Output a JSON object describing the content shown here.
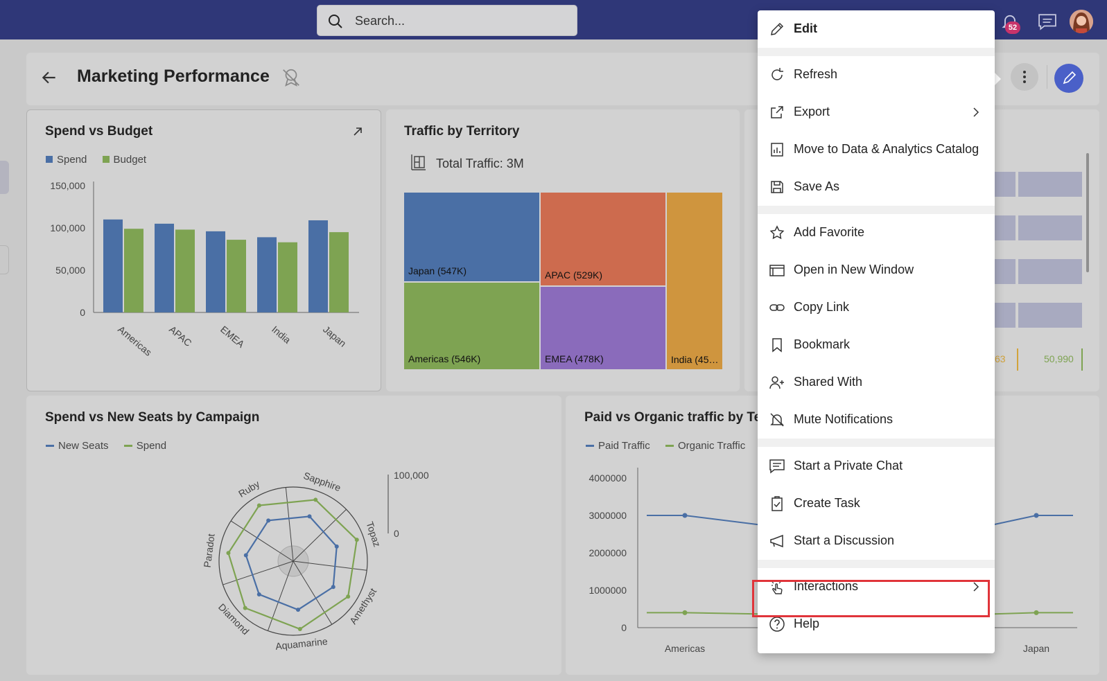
{
  "search": {
    "placeholder": "Search..."
  },
  "notifications": {
    "count": "52"
  },
  "page": {
    "title": "Marketing Performance"
  },
  "spend_budget": {
    "title": "Spend vs Budget",
    "legend": [
      "Spend",
      "Budget"
    ],
    "colors": [
      "#4a6fa5",
      "#7ea352"
    ]
  },
  "traffic": {
    "title": "Traffic by Territory",
    "total": "Total Traffic: 3M",
    "cells": [
      "Japan (547K)",
      "APAC (529K)",
      "Americas (546K)",
      "EMEA (478K)",
      "India (45…"
    ]
  },
  "campaign": {
    "title": "Spend vs New Seats by Campaign",
    "legend": [
      "New Seats",
      "Spend"
    ]
  },
  "paid_organic": {
    "title": "Paid vs Organic traffic by Te",
    "legend": [
      "Paid Traffic",
      "Organic Traffic"
    ]
  },
  "partial_card": {
    "value_a": "63",
    "value_b": "50,990"
  },
  "chart_data": [
    {
      "type": "bar",
      "title": "Spend vs Budget",
      "categories": [
        "Americas",
        "APAC",
        "EMEA",
        "India",
        "Japan"
      ],
      "series": [
        {
          "name": "Spend",
          "values": [
            110000,
            105000,
            96000,
            89000,
            109000
          ]
        },
        {
          "name": "Budget",
          "values": [
            99000,
            98000,
            86000,
            83000,
            95000
          ]
        }
      ],
      "ylim": [
        0,
        150000
      ],
      "yticks": [
        "150,000",
        "100,000",
        "50,000",
        "0"
      ]
    },
    {
      "type": "heatmap",
      "title": "Traffic by Territory",
      "categories": [
        "Japan",
        "APAC",
        "Americas",
        "EMEA",
        "India"
      ],
      "values": [
        547,
        529,
        546,
        478,
        450
      ]
    },
    {
      "type": "line",
      "title": "Spend vs New Seats by Campaign",
      "categories": [
        "Sapphire",
        "Topaz",
        "Amethyst",
        "Aquamarine",
        "Diamond",
        "Paradot",
        "Ruby"
      ],
      "series": [
        {
          "name": "New Seats",
          "values": [
            55000,
            52000,
            55000,
            57000,
            55000,
            55000,
            55000
          ]
        },
        {
          "name": "Spend",
          "values": [
            85000,
            88000,
            85000,
            90000,
            88000,
            85000,
            85000
          ]
        }
      ],
      "ylim": [
        0,
        100000
      ],
      "yticks": [
        "100,000",
        "0"
      ]
    },
    {
      "type": "line",
      "title": "Paid vs Organic traffic by Te",
      "categories": [
        "Americas",
        "Japan"
      ],
      "series": [
        {
          "name": "Paid Traffic",
          "values": [
            3000000,
            3000000
          ]
        },
        {
          "name": "Organic Traffic",
          "values": [
            400000,
            400000
          ]
        }
      ],
      "ylim": [
        0,
        4000000
      ],
      "yticks": [
        "4000000",
        "3000000",
        "2000000",
        "1000000",
        "0"
      ]
    }
  ],
  "menu": {
    "items": [
      {
        "label": "Edit"
      },
      {
        "label": "Refresh"
      },
      {
        "label": "Export"
      },
      {
        "label": "Move to Data & Analytics Catalog"
      },
      {
        "label": "Save As"
      },
      {
        "label": "Add Favorite"
      },
      {
        "label": "Open in New Window"
      },
      {
        "label": "Copy Link"
      },
      {
        "label": "Bookmark"
      },
      {
        "label": "Shared With"
      },
      {
        "label": "Mute Notifications"
      },
      {
        "label": "Start a Private Chat"
      },
      {
        "label": "Create Task"
      },
      {
        "label": "Start a Discussion"
      },
      {
        "label": "Interactions"
      },
      {
        "label": "Help"
      }
    ]
  }
}
